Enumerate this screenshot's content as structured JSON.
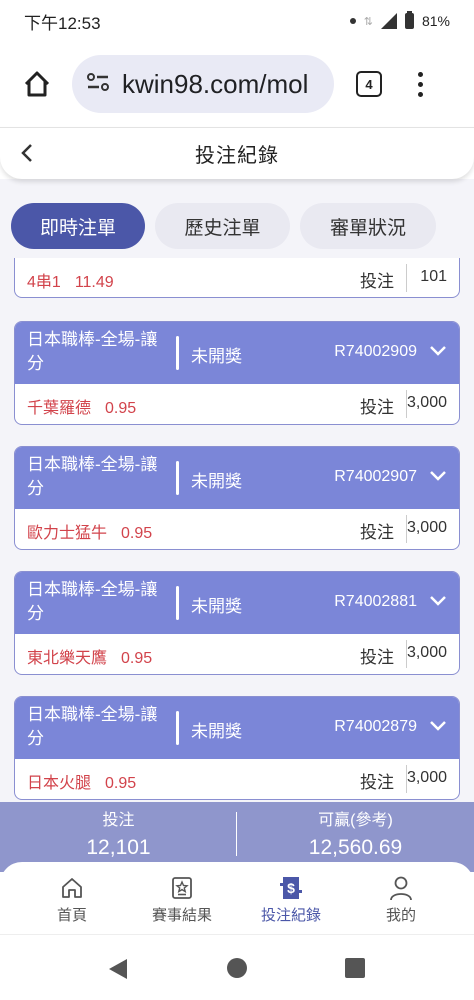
{
  "status_bar": {
    "time": "下午12:53",
    "battery": "81%"
  },
  "browser": {
    "url": "kwin98.com/mol",
    "tab_count": "4"
  },
  "header": {
    "title": "投注紀錄"
  },
  "tabs": [
    {
      "label": "即時注單",
      "active": true
    },
    {
      "label": "歷史注單",
      "active": false
    },
    {
      "label": "審單狀況",
      "active": false
    }
  ],
  "partial_card": {
    "pick": "4串1",
    "odds": "11.49",
    "bet_label": "投注",
    "amount": "101"
  },
  "cards": [
    {
      "league": "日本職棒-全場-讓分",
      "status": "未開獎",
      "id": "R74002909",
      "pick": "千葉羅德",
      "odds": "0.95",
      "bet_label": "投注",
      "amount": "3,000"
    },
    {
      "league": "日本職棒-全場-讓分",
      "status": "未開獎",
      "id": "R74002907",
      "pick": "歐力士猛牛",
      "odds": "0.95",
      "bet_label": "投注",
      "amount": "3,000"
    },
    {
      "league": "日本職棒-全場-讓分",
      "status": "未開獎",
      "id": "R74002881",
      "pick": "東北樂天鷹",
      "odds": "0.95",
      "bet_label": "投注",
      "amount": "3,000"
    },
    {
      "league": "日本職棒-全場-讓分",
      "status": "未開獎",
      "id": "R74002879",
      "pick": "日本火腿",
      "odds": "0.95",
      "bet_label": "投注",
      "amount": "3,000"
    }
  ],
  "summary": {
    "bet_label": "投注",
    "bet_value": "12,101",
    "win_label": "可贏(參考)",
    "win_value": "12,560.69"
  },
  "bottom_nav": [
    {
      "label": "首頁",
      "icon": "home-icon"
    },
    {
      "label": "賽事結果",
      "icon": "results-icon"
    },
    {
      "label": "投注紀錄",
      "icon": "bet-record-icon",
      "active": true
    },
    {
      "label": "我的",
      "icon": "profile-icon"
    }
  ],
  "colors": {
    "accent": "#4b57a8",
    "card_header": "#7b86d8",
    "pick_red": "#d2434b",
    "summary_bg": "#8f96cc"
  }
}
